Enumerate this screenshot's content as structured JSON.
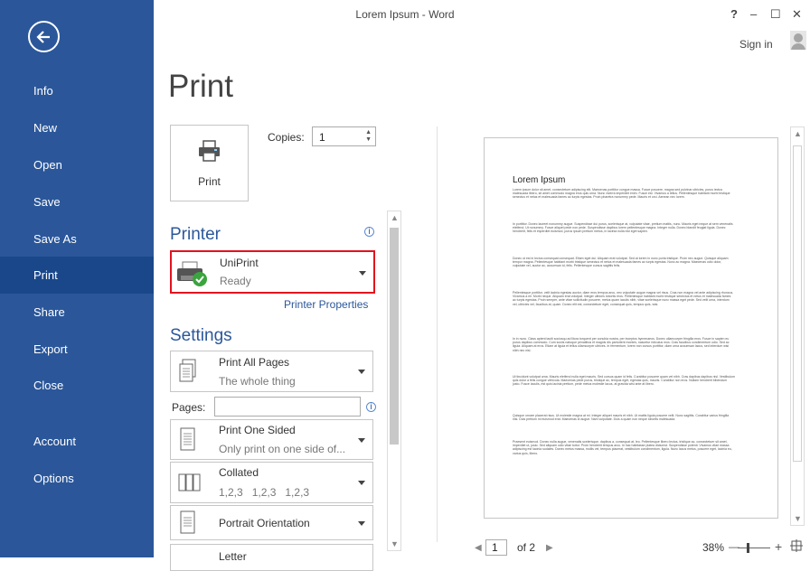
{
  "window": {
    "title": "Lorem Ipsum - Word",
    "help": "?",
    "minimize": "–",
    "maximize": "☐",
    "close": "✕",
    "sign_in": "Sign in"
  },
  "sidebar": {
    "items": [
      {
        "label": "Info"
      },
      {
        "label": "New"
      },
      {
        "label": "Open"
      },
      {
        "label": "Save"
      },
      {
        "label": "Save As"
      },
      {
        "label": "Print"
      },
      {
        "label": "Share"
      },
      {
        "label": "Export"
      },
      {
        "label": "Close"
      },
      {
        "label": "Account"
      },
      {
        "label": "Options"
      }
    ],
    "selected": "Print"
  },
  "print": {
    "heading": "Print",
    "button_label": "Print",
    "copies_label": "Copies:",
    "copies_value": "1",
    "printer_section": "Printer",
    "printer_name": "UniPrint",
    "printer_status": "Ready",
    "printer_properties": "Printer Properties",
    "settings_section": "Settings",
    "pages_label": "Pages:",
    "pages_value": "",
    "settings": [
      {
        "title": "Print All Pages",
        "subtitle": "The whole thing"
      },
      {
        "title": "Print One Sided",
        "subtitle": "Only print on one side of..."
      },
      {
        "title": "Collated",
        "subtitle": "1,2,3   1,2,3   1,2,3"
      },
      {
        "title": "Portrait Orientation",
        "subtitle": ""
      },
      {
        "title": "Letter",
        "subtitle": ""
      }
    ]
  },
  "preview": {
    "doc_title": "Lorem Ipsum",
    "paragraphs": [
      "Lorem ipsum dolor sit amet, consectetuer adipiscing elit. Maecenas porttitor congue massa. Fusce posuere, magna sed pulvinar ultricies, purus lectus malesuada libero, sit amet commodo magna eros quis urna. Nunc viverra imperdiet enim. Fusce est. Vivamus a tellus. Pellentesque habitant morbi tristique senectus et netus et malesuada fames ac turpis egestas. Proin pharetra nonummy pede. Mauris et orci. Aenean nec lorem.",
      "In porttitor. Donec laoreet nonummy augue. Suspendisse dui purus, scelerisque at, vulputate vitae, pretium mattis, nunc. Mauris eget neque at sem venenatis eleifend. Ut nonummy. Fusce aliquet pede non pede. Suspendisse dapibus lorem pellentesque magna. Integer nulla. Donec blandit feugiat ligula. Donec hendrerit, felis et imperdiet euismod, purus ipsum pretium metus, in lacinia nulla nisl eget sapien.",
      "Donec ut est in lectus consequat consequat. Etiam eget dui. Aliquam erat volutpat. Sed at lorem in nunc porta tristique. Proin nec augue. Quisque aliquam tempor magna. Pellentesque habitant morbi tristique senectus et netus et malesuada fames ac turpis egestas. Nunc ac magna. Maecenas odio dolor, vulputate vel, auctor ac, accumsan id, felis. Pellentesque cursus sagittis felis.",
      "Pellentesque porttitor, velit lacinia egestas auctor, diam eros tempus arcu, nec vulputate augue magna vel risus. Cras non magna vel ante adipiscing rhoncus. Vivamus a mi. Morbi neque. Aliquam erat volutpat. Integer ultrices lobortis eros. Pellentesque habitant morbi tristique senectus et netus et malesuada fames ac turpis egestas. Proin semper, ante vitae sollicitudin posuere, metus quam iaculis nibh, vitae scelerisque nunc massa eget pede. Sed velit urna, interdum vel, ultricies vel, faucibus at, quam. Donec elit est, consectetuer eget, consequat quis, tempus quis, wisi.",
      "In in nunc. Class aptent taciti sociosqu ad litora torquent per conubia nostra, per inceptos hymenaeos. Donec ullamcorper fringilla eros. Fusce in sapien eu purus dapibus commodo. Cum sociis natoque penatibus et magnis dis parturient montes, nascetur ridiculus mus. Cras faucibus condimentum odio. Sed ac ligula. Aliquam at eros. Etiam at ligula et tellus ullamcorper ultrices. In fermentum, lorem non cursus porttitor, diam urna accumsan lacus, sed interdum wisi nibh nec nisl.",
      "Ut tincidunt volutpat urna. Mauris eleifend nulla eget mauris. Sed cursus quam id felis. Curabitur posuere quam vel nibh. Cras dapibus dapibus nisl. Vestibulum quis dolor a felis congue vehicula. Maecenas pede purus, tristique ac, tempus eget, egestas quis, mauris. Curabitur non eros. Nullam hendrerit bibendum justo. Fusce iaculis, est quis lacinia pretium, pede metus molestie lacus, at gravida wisi ante at libero.",
      "Quisque ornare placerat risus. Ut molestie magna at mi. Integer aliquet mauris et nibh. Ut mattis ligula posuere velit. Nunc sagittis. Curabitur varius fringilla nisl. Duis pretium mi euismod erat. Maecenas id augue. Nam vulputate. Duis a quam non neque lobortis malesuada.",
      "Praesent euismod. Donec nulla augue, venenatis scelerisque, dapibus a, consequat at, leo. Pellentesque libero lectus, tristique ac, consectetuer sit amet, imperdiet ut, justo. Sed aliquam odio vitae tortor. Proin hendrerit tempus arcu. In hac habitasse platea dictumst. Suspendisse potenti. Vivamus vitae massa adipiscing est lacinia sodales. Donec metus massa, mollis vel, tempus placerat, vestibulum condimentum, ligula. Nunc lacus metus, posuere eget, lacinia eu, varius quis, libero."
    ]
  },
  "footer": {
    "page_current": "1",
    "page_of": "of 2",
    "zoom": "38%",
    "zoom_minus": "—",
    "zoom_plus": "+"
  }
}
